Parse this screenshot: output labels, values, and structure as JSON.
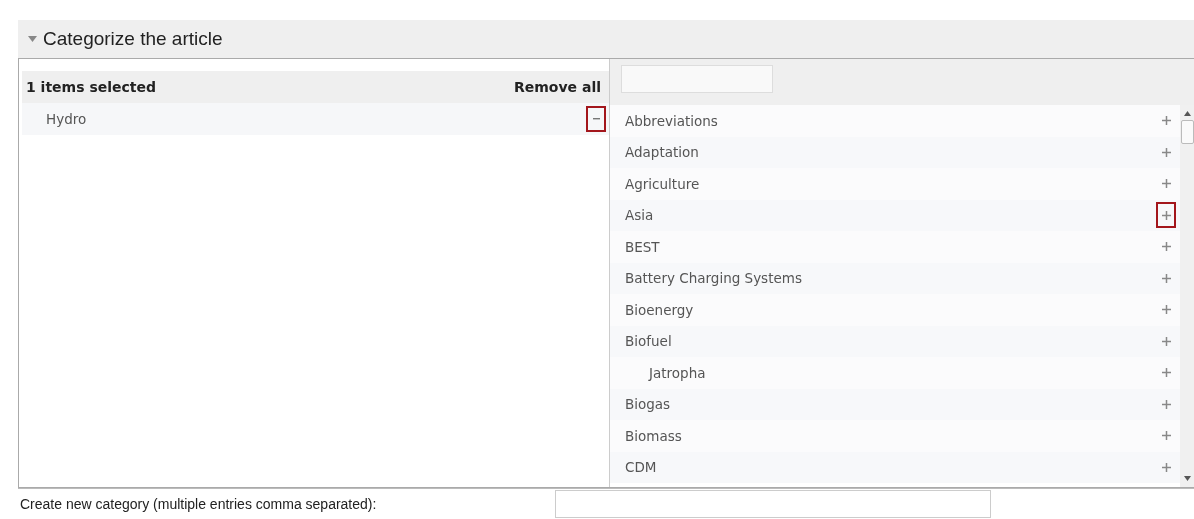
{
  "section": {
    "title": "Categorize the article",
    "expanded": true
  },
  "selected_panel": {
    "count_label": "1 items selected",
    "remove_all": "Remove all",
    "items": [
      {
        "name": "Hydro",
        "highlighted": true
      }
    ]
  },
  "category_list": {
    "items": [
      {
        "name": "Abbreviations",
        "highlighted": false
      },
      {
        "name": "Adaptation",
        "highlighted": false
      },
      {
        "name": "Agriculture",
        "highlighted": false
      },
      {
        "name": "Asia",
        "highlighted": true
      },
      {
        "name": "BEST",
        "highlighted": false
      },
      {
        "name": "Battery Charging Systems",
        "highlighted": false
      },
      {
        "name": "Bioenergy",
        "highlighted": false
      },
      {
        "name": "Biofuel",
        "highlighted": false,
        "children": [
          {
            "name": "Jatropha",
            "highlighted": false
          }
        ]
      },
      {
        "name": "Biogas",
        "highlighted": false
      },
      {
        "name": "Biomass",
        "highlighted": false
      },
      {
        "name": "CDM",
        "highlighted": false
      }
    ]
  },
  "new_category": {
    "label": "Create new category (multiple entries comma separated):"
  }
}
